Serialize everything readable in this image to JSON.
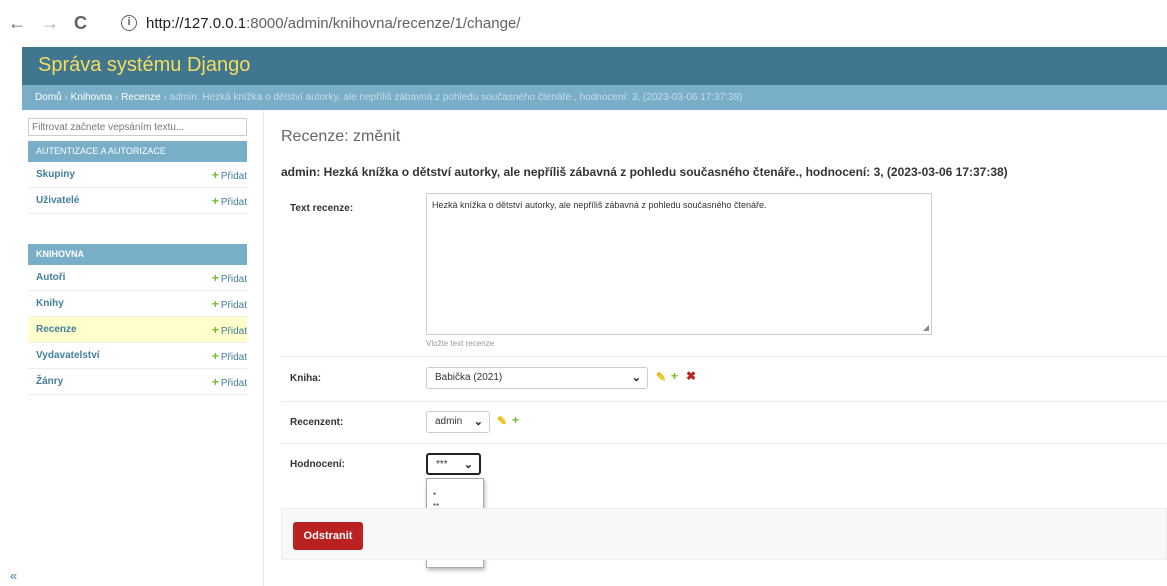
{
  "browser": {
    "back_icon": "←",
    "forward_icon": "→",
    "reload_icon": "C",
    "info_icon": "i",
    "url_host": "http://127.0.0.1",
    "url_rest": ":8000/admin/knihovna/recenze/1/change/"
  },
  "header": {
    "brand": "Správa systému Django"
  },
  "breadcrumb": {
    "home": "Domů",
    "sep": " › ",
    "app": "Knihovna",
    "model": "Recenze",
    "current": "admin: Hezká knížka o dětství autorky, ale nepříliš zábavná z pohledu současného čtenáře., hodnocení: 3, (2023-03-06 17:37:38)"
  },
  "sidebar": {
    "filter_placeholder": "Filtrovat začnete vepsáním textu...",
    "auth_header": "Autentizace a autorizace",
    "auth_items": [
      {
        "label": "Skupiny",
        "add": "Přidat"
      },
      {
        "label": "Uživatelé",
        "add": "Přidat"
      }
    ],
    "app_header": "Knihovna",
    "app_items": [
      {
        "label": "Autoři",
        "add": "Přidat"
      },
      {
        "label": "Knihy",
        "add": "Přidat"
      },
      {
        "label": "Recenze",
        "add": "Přidat"
      },
      {
        "label": "Vydavatelství",
        "add": "Přidat"
      },
      {
        "label": "Žánry",
        "add": "Přidat"
      }
    ],
    "collapse": "«"
  },
  "main": {
    "title": "Recenze: změnit",
    "subtitle": "admin: Hezká knížka o dětství autorky, ale nepříliš zábavná z pohledu současného čtenáře., hodnocení: 3, (2023-03-06 17:37:38)",
    "text_label": "Text recenze:",
    "text_value": "Hezká knížka o dětství autorky, ale nepříliš zábavná z pohledu současného čtenáře.",
    "text_help": "Vložte text recenze",
    "kniha_label": "Kniha:",
    "kniha_value": "Babička (2021)",
    "recenzent_label": "Recenzent:",
    "recenzent_value": "admin",
    "hodnoceni_label": "Hodnocení:",
    "hodnoceni_value": "***",
    "hodnoceni_options": [
      "",
      "*",
      "**",
      "***",
      "****",
      "*****"
    ],
    "delete_label": "Odstranit"
  }
}
